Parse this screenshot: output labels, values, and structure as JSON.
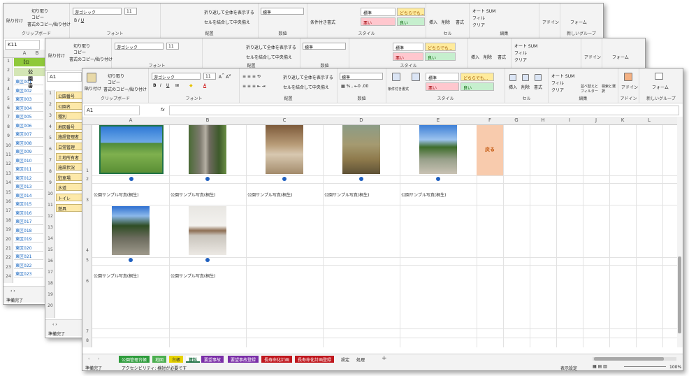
{
  "ribbon": {
    "paste": "貼り付け",
    "cut": "切り取り",
    "copy": "コピー",
    "format_painter": "書式のコピー/貼り付け",
    "clipboard_group": "クリップボード",
    "font_name": "游ゴシック",
    "font_size": "11",
    "font_group": "フォント",
    "wrap_text": "折り返して全体を表示する",
    "merge_center": "セルを結合して中央揃え",
    "align_group": "配置",
    "number_format": "標準",
    "number_group": "数値",
    "conditional": "条件付き書式",
    "table_format": "テーブルとして書式設定",
    "style_group": "スタイル",
    "style_standard": "標準",
    "style_neutral": "どちらでも...",
    "style_bad": "悪い",
    "style_good": "良い",
    "insert": "挿入",
    "delete": "削除",
    "format": "書式",
    "cell_group": "セル",
    "autosum": "オート SUM",
    "fill": "フィル",
    "clear": "クリア",
    "sort_filter": "並べ替えとフィルター",
    "find_select": "検索と選択",
    "edit_group": "編集",
    "addin": "アドイン",
    "addin_group": "アドイン",
    "form": "フォーム",
    "new_group": "新しいグループ"
  },
  "win1": {
    "namebox": "K11",
    "cols": [
      "A",
      "B"
    ],
    "rows": [
      "1",
      "2",
      "3",
      "4",
      "5",
      "6",
      "7",
      "8",
      "9",
      "10",
      "11",
      "12",
      "13",
      "14",
      "15",
      "16",
      "17",
      "18",
      "19",
      "20",
      "21",
      "22",
      "23",
      "24"
    ],
    "header_green": "【公",
    "header_cell": "公園番",
    "ids": [
      "東区001",
      "東区002",
      "東区003",
      "東区004",
      "東区005",
      "東区006",
      "東区007",
      "東区008",
      "東区009",
      "東区010",
      "東区011",
      "東区012",
      "東区013",
      "東区014",
      "東区015",
      "東区016",
      "東区017",
      "東区018",
      "東区019",
      "東区020",
      "東区021",
      "東区022",
      "東区023"
    ],
    "status": "準備完了"
  },
  "win2": {
    "namebox": "A1",
    "rows": [
      "1",
      "2",
      "3",
      "4",
      "5",
      "6",
      "7",
      "8",
      "9",
      "10",
      "11",
      "12",
      "13",
      "14",
      "15",
      "16",
      "17",
      "18",
      "19",
      "20"
    ],
    "labels": [
      "公園番号",
      "公園名",
      "種別",
      "地図番号",
      "施設管理者",
      "日常管理",
      "土地所有者",
      "施設状況",
      "駐車場",
      "水道",
      "トイレ",
      "遊具"
    ],
    "status": "準備完了"
  },
  "win3": {
    "namebox": "A1",
    "fx": "fx",
    "cols": [
      "A",
      "B",
      "C",
      "D",
      "E",
      "F",
      "G",
      "H",
      "I",
      "J",
      "K",
      "L"
    ],
    "rows": [
      "1",
      "2",
      "3",
      "4",
      "5",
      "6",
      "7",
      "8"
    ],
    "back_button": "戻る",
    "captions": [
      "公園サンプル写真(桐生)",
      "公園サンプル写真(桐生)",
      "公園サンプル写真(桐生)",
      "公園サンプル写真(桐生)",
      "公園サンプル写真(桐生)",
      "公園サンプル写真(桐生)",
      "公園サンプル写真(桐生)"
    ],
    "tabs": [
      {
        "label": "公園管理台帳",
        "color": "#2e9c3c"
      },
      {
        "label": "地図",
        "color": "#4caf50"
      },
      {
        "label": "台帳",
        "color": "#e6d200"
      },
      {
        "label": "資料",
        "color": "#ffffff"
      },
      {
        "label": "要望事故",
        "color": "#7b2fa8"
      },
      {
        "label": "要望事故登録",
        "color": "#7b2fa8"
      },
      {
        "label": "長寿命化計画",
        "color": "#c0181e"
      },
      {
        "label": "長寿命化計画登録",
        "color": "#c0181e"
      },
      {
        "label": "設定",
        "color": "#f3f3f3"
      },
      {
        "label": "処理",
        "color": "#f3f3f3"
      }
    ],
    "add_sheet": "+",
    "status_ready": "準備完了",
    "accessibility": "アクセシビリティ: 検討が必要です",
    "display_settings": "表示設定",
    "zoom": "100%"
  }
}
